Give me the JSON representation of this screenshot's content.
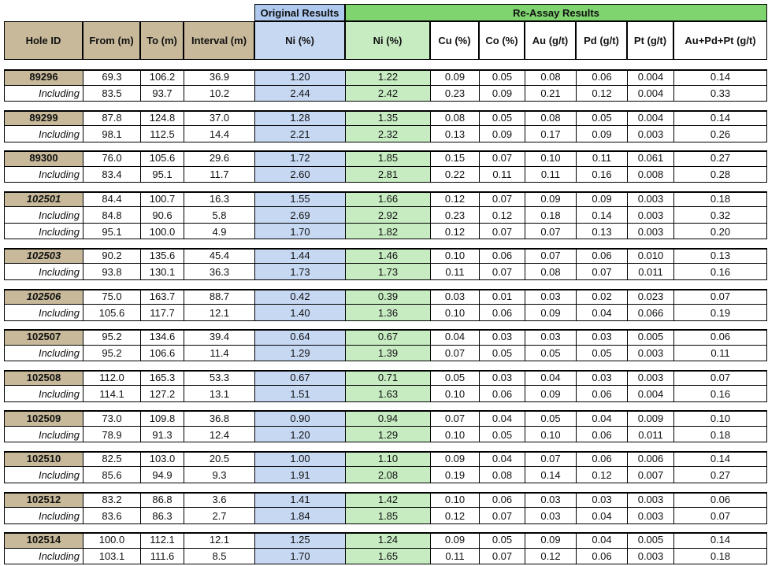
{
  "table": {
    "group_headers": {
      "original": "Original Results",
      "reassay": "Re-Assay Results"
    },
    "columns": [
      "Hole ID",
      "From (m)",
      "To (m)",
      "Interval (m)",
      "Ni (%)",
      "Ni (%)",
      "Cu (%)",
      "Co (%)",
      "Au (g/t)",
      "Pd (g/t)",
      "Pt (g/t)",
      "Au+Pd+Pt (g/t)"
    ],
    "colors": {
      "tan": "#c7b99a",
      "blue": "#c7d8f3",
      "green": "#c7ecc2",
      "green_header": "#7fd46f",
      "blue_header": "#aec8ee"
    },
    "groups": [
      {
        "hole": "89296",
        "italic": false,
        "rows": [
          [
            "89296",
            "69.3",
            "106.2",
            "36.9",
            "1.20",
            "1.22",
            "0.09",
            "0.05",
            "0.08",
            "0.06",
            "0.004",
            "0.14"
          ],
          [
            "Including",
            "83.5",
            "93.7",
            "10.2",
            "2.44",
            "2.42",
            "0.23",
            "0.09",
            "0.21",
            "0.12",
            "0.004",
            "0.33"
          ]
        ]
      },
      {
        "hole": "89299",
        "italic": false,
        "rows": [
          [
            "89299",
            "87.8",
            "124.8",
            "37.0",
            "1.28",
            "1.35",
            "0.08",
            "0.05",
            "0.08",
            "0.05",
            "0.004",
            "0.14"
          ],
          [
            "Including",
            "98.1",
            "112.5",
            "14.4",
            "2.21",
            "2.32",
            "0.13",
            "0.09",
            "0.17",
            "0.09",
            "0.003",
            "0.26"
          ]
        ]
      },
      {
        "hole": "89300",
        "italic": false,
        "rows": [
          [
            "89300",
            "76.0",
            "105.6",
            "29.6",
            "1.72",
            "1.85",
            "0.15",
            "0.07",
            "0.10",
            "0.11",
            "0.061",
            "0.27"
          ],
          [
            "Including",
            "83.4",
            "95.1",
            "11.7",
            "2.60",
            "2.81",
            "0.22",
            "0.11",
            "0.11",
            "0.16",
            "0.008",
            "0.28"
          ]
        ]
      },
      {
        "hole": "102501",
        "italic": true,
        "rows": [
          [
            "102501",
            "84.4",
            "100.7",
            "16.3",
            "1.55",
            "1.66",
            "0.12",
            "0.07",
            "0.09",
            "0.09",
            "0.003",
            "0.18"
          ],
          [
            "Including",
            "84.8",
            "90.6",
            "5.8",
            "2.69",
            "2.92",
            "0.23",
            "0.12",
            "0.18",
            "0.14",
            "0.003",
            "0.32"
          ],
          [
            "Including",
            "95.1",
            "100.0",
            "4.9",
            "1.70",
            "1.82",
            "0.12",
            "0.07",
            "0.07",
            "0.13",
            "0.003",
            "0.20"
          ]
        ]
      },
      {
        "hole": "102503",
        "italic": true,
        "rows": [
          [
            "102503",
            "90.2",
            "135.6",
            "45.4",
            "1.44",
            "1.46",
            "0.10",
            "0.06",
            "0.07",
            "0.06",
            "0.010",
            "0.13"
          ],
          [
            "Including",
            "93.8",
            "130.1",
            "36.3",
            "1.73",
            "1.73",
            "0.11",
            "0.07",
            "0.08",
            "0.07",
            "0.011",
            "0.16"
          ]
        ]
      },
      {
        "hole": "102506",
        "italic": true,
        "rows": [
          [
            "102506",
            "75.0",
            "163.7",
            "88.7",
            "0.42",
            "0.39",
            "0.03",
            "0.01",
            "0.03",
            "0.02",
            "0.023",
            "0.07"
          ],
          [
            "Including",
            "105.6",
            "117.7",
            "12.1",
            "1.40",
            "1.36",
            "0.10",
            "0.06",
            "0.09",
            "0.04",
            "0.066",
            "0.19"
          ]
        ]
      },
      {
        "hole": "102507",
        "italic": false,
        "rows": [
          [
            "102507",
            "95.2",
            "134.6",
            "39.4",
            "0.64",
            "0.67",
            "0.04",
            "0.03",
            "0.03",
            "0.03",
            "0.005",
            "0.06"
          ],
          [
            "Including",
            "95.2",
            "106.6",
            "11.4",
            "1.29",
            "1.39",
            "0.07",
            "0.05",
            "0.05",
            "0.05",
            "0.003",
            "0.11"
          ]
        ]
      },
      {
        "hole": "102508",
        "italic": false,
        "rows": [
          [
            "102508",
            "112.0",
            "165.3",
            "53.3",
            "0.67",
            "0.71",
            "0.05",
            "0.03",
            "0.04",
            "0.03",
            "0.003",
            "0.07"
          ],
          [
            "Including",
            "114.1",
            "127.2",
            "13.1",
            "1.51",
            "1.63",
            "0.10",
            "0.06",
            "0.09",
            "0.06",
            "0.004",
            "0.16"
          ]
        ]
      },
      {
        "hole": "102509",
        "italic": false,
        "rows": [
          [
            "102509",
            "73.0",
            "109.8",
            "36.8",
            "0.90",
            "0.94",
            "0.07",
            "0.04",
            "0.05",
            "0.04",
            "0.009",
            "0.10"
          ],
          [
            "Including",
            "78.9",
            "91.3",
            "12.4",
            "1.20",
            "1.29",
            "0.10",
            "0.05",
            "0.10",
            "0.06",
            "0.011",
            "0.18"
          ]
        ]
      },
      {
        "hole": "102510",
        "italic": false,
        "rows": [
          [
            "102510",
            "82.5",
            "103.0",
            "20.5",
            "1.00",
            "1.10",
            "0.09",
            "0.04",
            "0.07",
            "0.06",
            "0.006",
            "0.14"
          ],
          [
            "Including",
            "85.6",
            "94.9",
            "9.3",
            "1.91",
            "2.08",
            "0.19",
            "0.08",
            "0.14",
            "0.12",
            "0.007",
            "0.27"
          ]
        ]
      },
      {
        "hole": "102512",
        "italic": false,
        "rows": [
          [
            "102512",
            "83.2",
            "86.8",
            "3.6",
            "1.41",
            "1.42",
            "0.10",
            "0.06",
            "0.03",
            "0.03",
            "0.003",
            "0.06"
          ],
          [
            "Including",
            "83.6",
            "86.3",
            "2.7",
            "1.84",
            "1.85",
            "0.12",
            "0.07",
            "0.03",
            "0.04",
            "0.003",
            "0.07"
          ]
        ]
      },
      {
        "hole": "102514",
        "italic": false,
        "rows": [
          [
            "102514",
            "100.0",
            "112.1",
            "12.1",
            "1.25",
            "1.24",
            "0.09",
            "0.05",
            "0.09",
            "0.04",
            "0.005",
            "0.14"
          ],
          [
            "Including",
            "103.1",
            "111.6",
            "8.5",
            "1.70",
            "1.65",
            "0.11",
            "0.07",
            "0.12",
            "0.06",
            "0.003",
            "0.18"
          ]
        ]
      }
    ]
  }
}
